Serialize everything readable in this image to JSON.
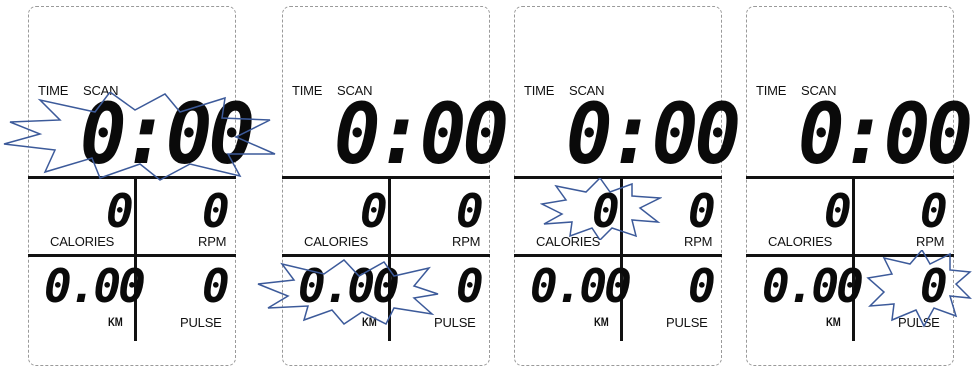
{
  "labels": {
    "time": "TIME",
    "scan": "SCAN",
    "calories": "CALORIES",
    "rpm": "RPM",
    "km": "KM",
    "pulse": "PULSE"
  },
  "panels": [
    {
      "time_value": "0:00",
      "calories": "0",
      "rpm": "0",
      "km": "0.00",
      "pulse": "0",
      "highlight": "time"
    },
    {
      "time_value": "0:00",
      "calories": "0",
      "rpm": "0",
      "km": "0.00",
      "pulse": "0",
      "highlight": "km"
    },
    {
      "time_value": "0:00",
      "calories": "0",
      "rpm": "0",
      "km": "0.00",
      "pulse": "0",
      "highlight": "calories"
    },
    {
      "time_value": "0:00",
      "calories": "0",
      "rpm": "0",
      "km": "0.00",
      "pulse": "0",
      "highlight": "pulse"
    }
  ],
  "colors": {
    "burst_stroke": "#3c5a9a",
    "segment": "#0a0a0a",
    "frame_border": "#9a9a9a"
  }
}
